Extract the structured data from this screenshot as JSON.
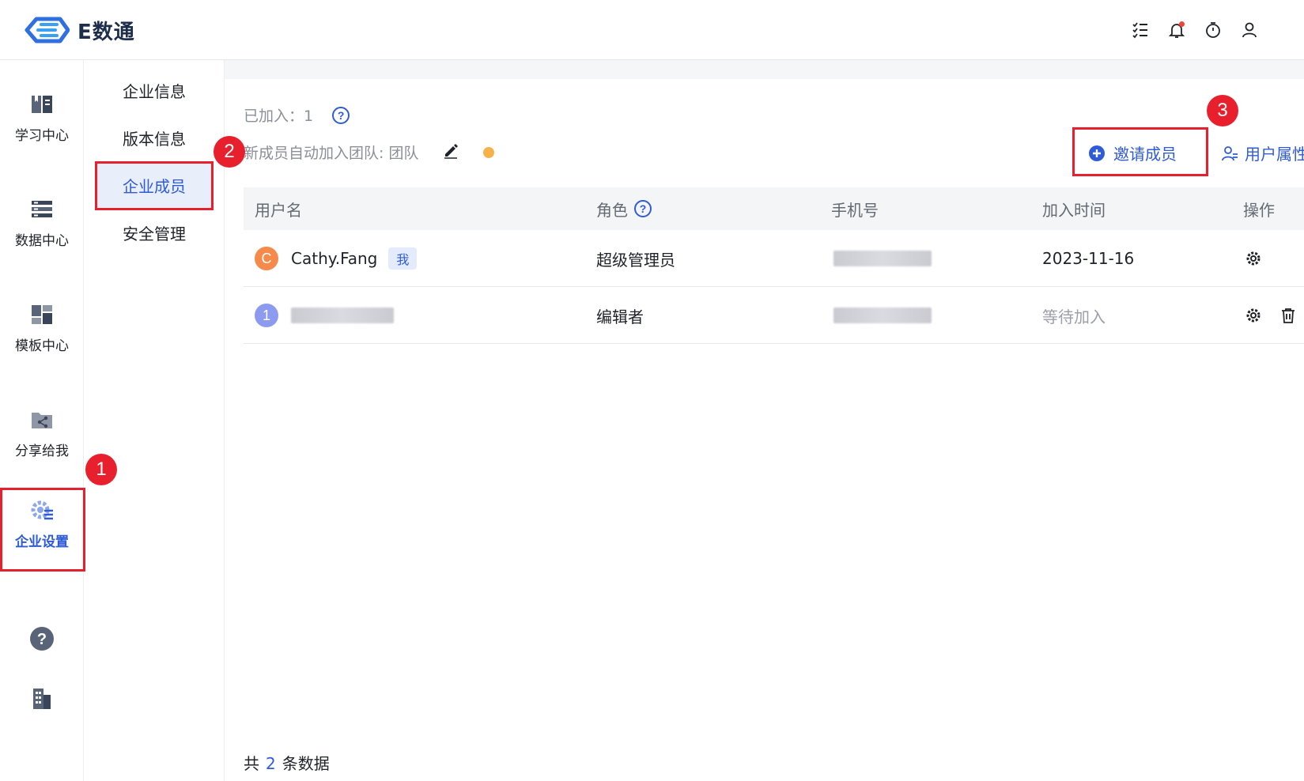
{
  "app": {
    "brand": "E数通"
  },
  "topbar": {
    "icons": [
      "todo-list-icon",
      "bell-icon",
      "timer-icon",
      "user-icon"
    ]
  },
  "leftnav": {
    "items": [
      {
        "label": "学习中心",
        "icon": "book-icon"
      },
      {
        "label": "数据中心",
        "icon": "database-icon"
      },
      {
        "label": "模板中心",
        "icon": "template-icon"
      },
      {
        "label": "分享给我",
        "icon": "share-icon"
      },
      {
        "label": "企业设置",
        "icon": "settings-icon",
        "active": true
      }
    ],
    "bottom_icons": [
      "help-icon",
      "building-icon"
    ]
  },
  "submenu": {
    "items": [
      {
        "label": "企业信息"
      },
      {
        "label": "版本信息"
      },
      {
        "label": "企业成员",
        "active": true
      },
      {
        "label": "安全管理"
      }
    ]
  },
  "annotations": {
    "one": "1",
    "two": "2",
    "three": "3"
  },
  "main": {
    "joined_label": "已加入：1",
    "auto_join_label": "新成员自动加入团队: 团队",
    "invite_label": "邀请成员",
    "user_attr_label": "用户属性",
    "table": {
      "headers": {
        "username": "用户名",
        "role": "角色",
        "phone": "手机号",
        "join_time": "加入时间",
        "actions": "操作"
      },
      "rows": [
        {
          "avatar_letter": "C",
          "avatar_color": "#f58a4b",
          "username": "Cathy.Fang",
          "me_tag": "我",
          "role": "超级管理员",
          "join_time": "2023-11-16"
        },
        {
          "avatar_letter": "1",
          "avatar_color": "#8c9bef",
          "username": "",
          "role": "编辑者",
          "join_time": "等待加入"
        }
      ]
    },
    "footer": {
      "prefix": "共",
      "count": "2",
      "suffix": "条数据"
    }
  },
  "colors": {
    "accent": "#2f5bd8",
    "highlight_red": "#e8202d"
  }
}
